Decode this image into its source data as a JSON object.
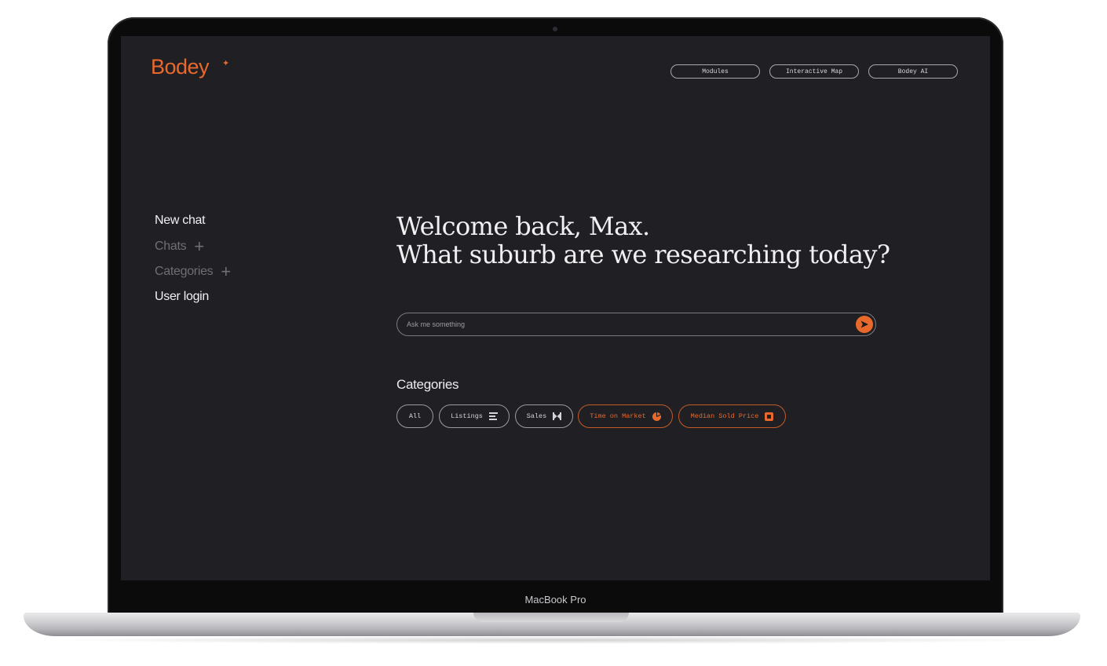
{
  "app": {
    "logo": "Bodey",
    "logo_mark": "✦"
  },
  "nav": {
    "items": [
      {
        "label": "Modules"
      },
      {
        "label": "Interactive Map"
      },
      {
        "label": "Bodey AI"
      }
    ]
  },
  "sidebar": {
    "items": [
      {
        "label": "New chat",
        "plus_icon": false
      },
      {
        "label": "Chats",
        "plus_icon": true
      },
      {
        "label": "Categories",
        "plus_icon": true
      },
      {
        "label": "User login",
        "plus_icon": false
      }
    ]
  },
  "hero": {
    "line1": "Welcome back, Max.",
    "line2": "What suburb are we researching today?"
  },
  "search": {
    "placeholder": "Ask me something",
    "value": "",
    "send_icon": "send-arrow-icon"
  },
  "categories": {
    "title": "Categories",
    "chips": [
      {
        "label": "All",
        "icon": "",
        "highlighted": false
      },
      {
        "label": "Listings",
        "icon": "bars-icon",
        "highlighted": false
      },
      {
        "label": "Sales",
        "icon": "bowtie-icon",
        "highlighted": false
      },
      {
        "label": "Time on Market",
        "icon": "pie-icon",
        "highlighted": true
      },
      {
        "label": "Median Sold Price",
        "icon": "square-icon",
        "highlighted": true
      }
    ]
  },
  "device": {
    "label": "MacBook Pro"
  },
  "colors": {
    "accent": "#e8692b",
    "background": "#202024",
    "text": "#f0f0f2",
    "muted": "#6e6e74"
  }
}
